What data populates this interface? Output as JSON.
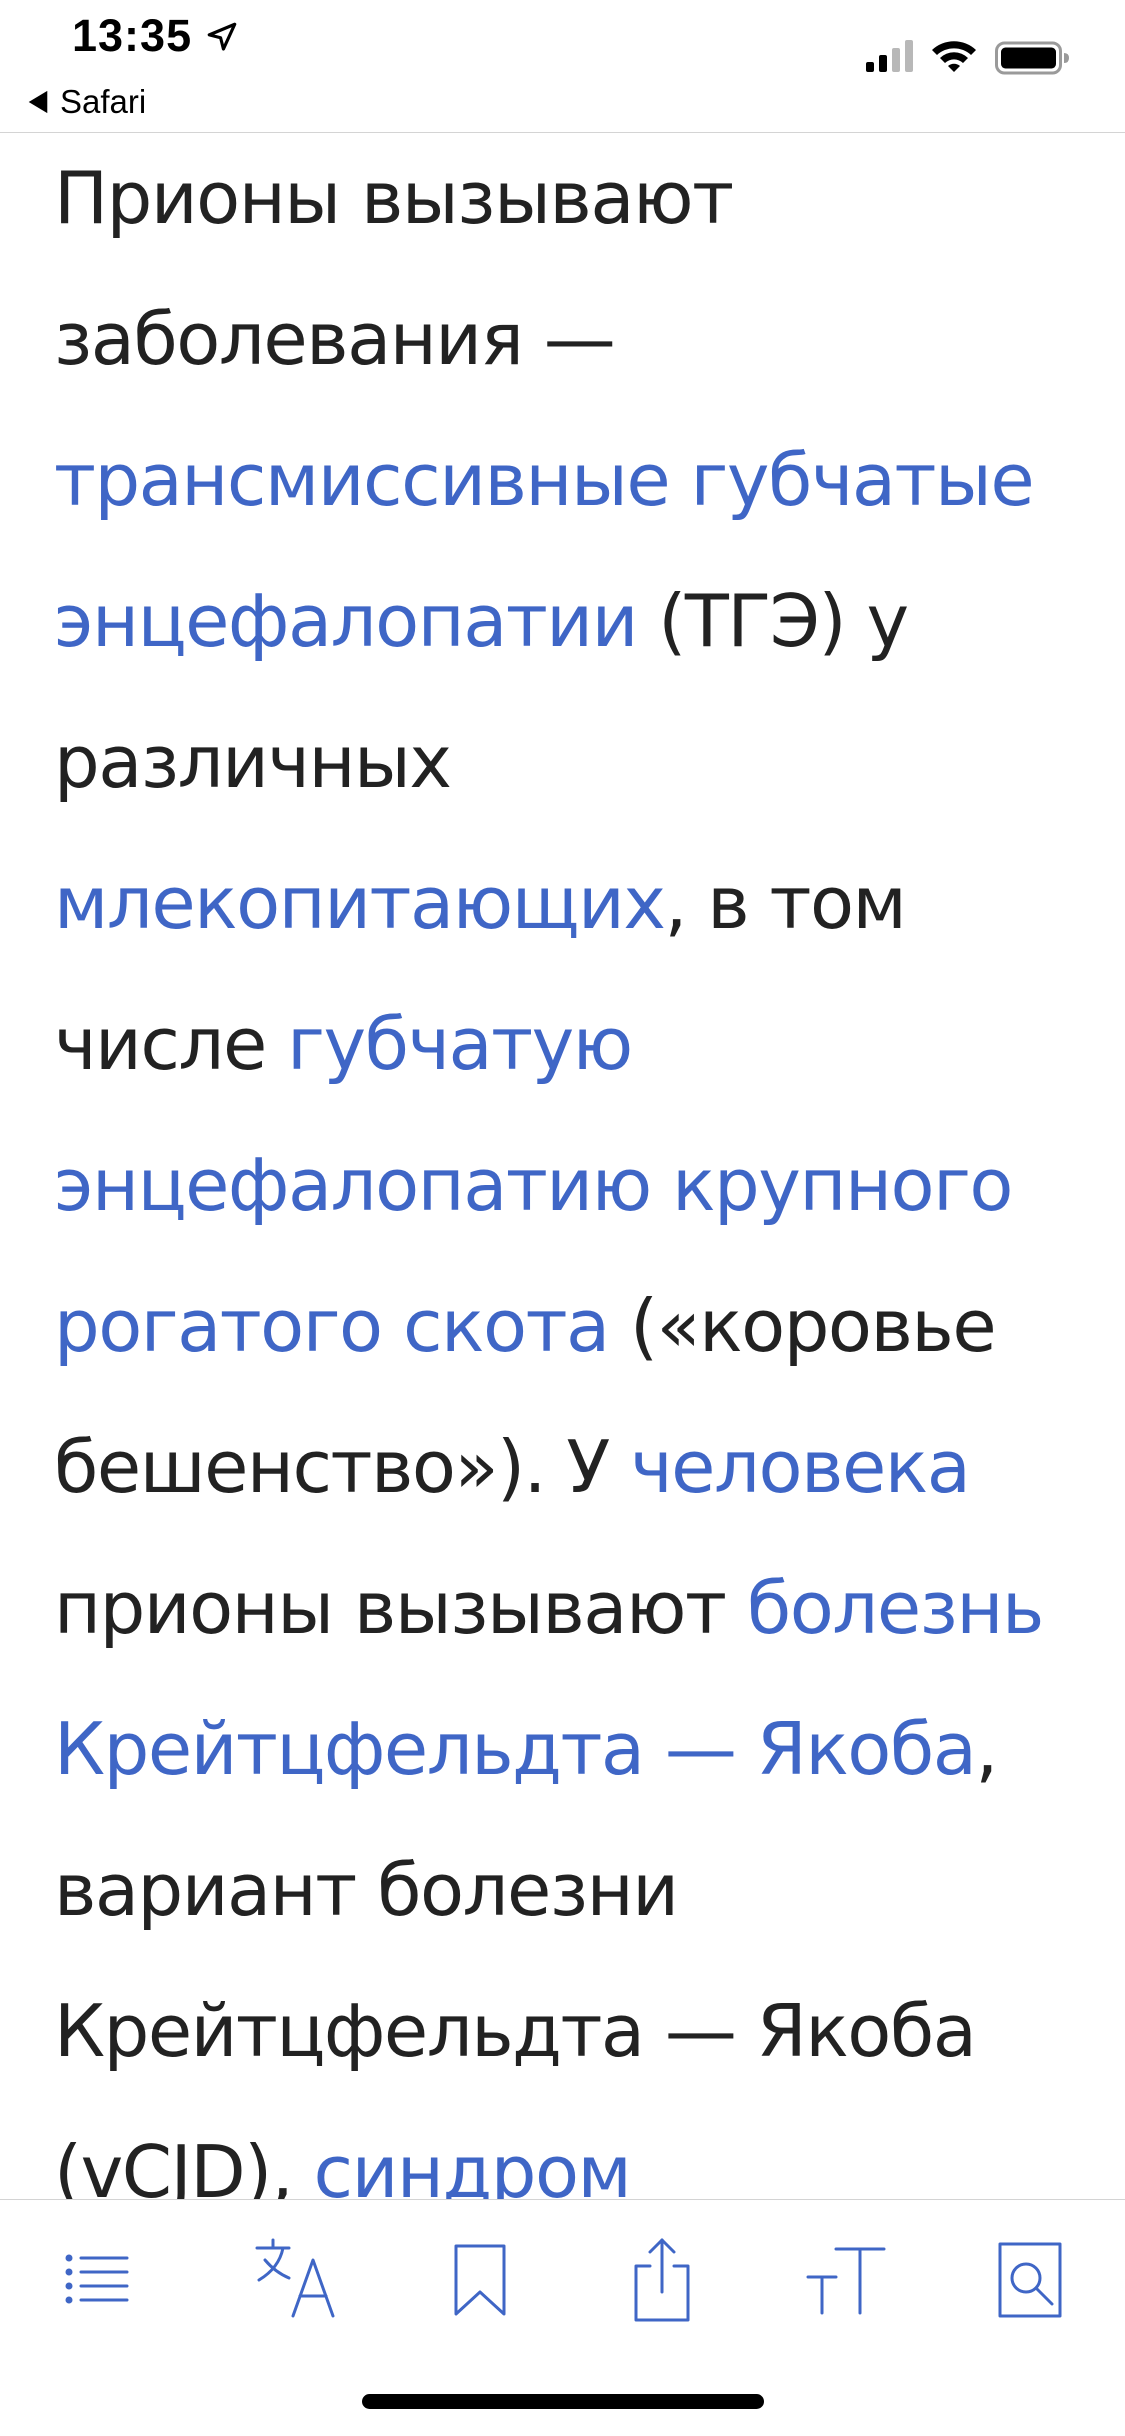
{
  "status_bar": {
    "time": "13:35",
    "back_label": "Safari"
  },
  "article": {
    "segments": [
      {
        "text": "Прионы вызывают заболевания — ",
        "link": false
      },
      {
        "text": "трансмиссивные губчатые энцефалопатии",
        "link": true
      },
      {
        "text": " (ТГЭ) у различных ",
        "link": false
      },
      {
        "text": "млекопитающих",
        "link": true
      },
      {
        "text": ", в том числе ",
        "link": false
      },
      {
        "text": "губчатую энцефалопатию крупного рогатого скота",
        "link": true
      },
      {
        "text": " («коровье бешенство»). У ",
        "link": false
      },
      {
        "text": "человека",
        "link": true
      },
      {
        "text": " прионы вызывают ",
        "link": false
      },
      {
        "text": "болезнь Крейтцфельдта — Якоба",
        "link": true
      },
      {
        "text": ", вариант болезни Крейтцфельдта — Якоба (vCJD), ",
        "link": false
      },
      {
        "text": "синдром",
        "link": true
      }
    ]
  },
  "toolbar": {
    "items": [
      {
        "name": "contents-list-icon"
      },
      {
        "name": "translate-icon"
      },
      {
        "name": "bookmark-icon"
      },
      {
        "name": "share-icon"
      },
      {
        "name": "text-size-icon"
      },
      {
        "name": "find-in-page-icon"
      }
    ]
  },
  "colors": {
    "link": "#3f66c6",
    "text": "#222222",
    "toolbar_icon": "#3f66c6"
  }
}
